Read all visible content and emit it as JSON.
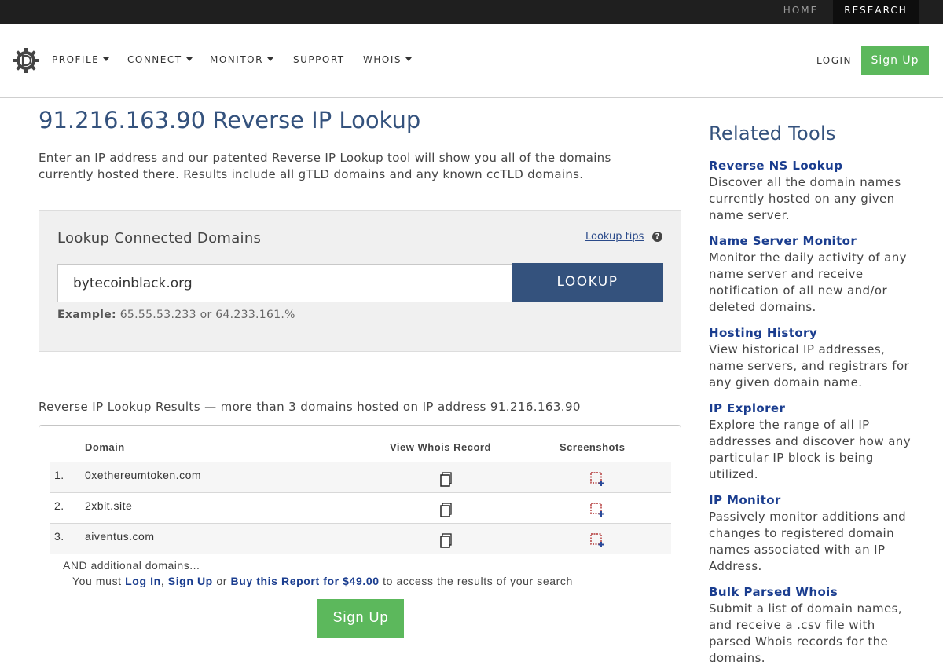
{
  "topbar": {
    "home": "HOME",
    "research": "RESEARCH"
  },
  "nav": {
    "items": [
      {
        "label": "PROFILE",
        "dropdown": true
      },
      {
        "label": "CONNECT",
        "dropdown": true
      },
      {
        "label": "MONITOR",
        "dropdown": true
      },
      {
        "label": "SUPPORT",
        "dropdown": false
      },
      {
        "label": "WHOIS",
        "dropdown": true
      }
    ],
    "login": "LOGIN",
    "signup": "Sign Up"
  },
  "main": {
    "title": "91.216.163.90 Reverse IP Lookup",
    "intro": "Enter an IP address and our patented Reverse IP Lookup tool will show you all of the domains currently hosted there. Results include all gTLD domains and any known ccTLD domains."
  },
  "lookup": {
    "title": "Lookup Connected Domains",
    "tips": "Lookup tips",
    "input_value": "bytecoinblack.org",
    "button": "LOOKUP",
    "example_label": "Example:",
    "example_text": "65.55.53.233 or 64.233.161.%"
  },
  "results": {
    "heading": "Reverse IP Lookup Results — more than 3 domains hosted on IP address 91.216.163.90",
    "columns": [
      "Domain",
      "View Whois Record",
      "Screenshots"
    ],
    "rows": [
      {
        "num": "1.",
        "domain": "0xethereumtoken.com"
      },
      {
        "num": "2.",
        "domain": "2xbit.site"
      },
      {
        "num": "3.",
        "domain": "aiventus.com"
      }
    ],
    "additional": "AND additional domains...",
    "must_prefix": "You must",
    "login_link": "Log In",
    "comma": ",",
    "signup_link": "Sign Up",
    "or": "or",
    "buy_link": "Buy this Report for $49.00",
    "must_suffix": "to access the results of your search",
    "signup_button": "Sign Up"
  },
  "sidebar": {
    "title": "Related Tools",
    "tools": [
      {
        "name": "Reverse NS Lookup",
        "desc": "Discover all the domain names currently hosted on any given name server."
      },
      {
        "name": "Name Server Monitor",
        "desc": "Monitor the daily activity of any name server and receive notification of all new and/or deleted domains."
      },
      {
        "name": "Hosting History",
        "desc": "View historical IP addresses, name servers, and registrars for any given domain name."
      },
      {
        "name": "IP Explorer",
        "desc": "Explore the range of all IP addresses and discover how any particular IP block is being utilized."
      },
      {
        "name": "IP Monitor",
        "desc": "Passively monitor additions and changes to registered domain names associated with an IP Address."
      },
      {
        "name": "Bulk Parsed Whois",
        "desc": "Submit a list of domain names, and receive a .csv file with parsed Whois records for the domains."
      }
    ]
  },
  "colors": {
    "brand_blue": "#34527d",
    "link_blue": "#1a3d8f",
    "green": "#5cb85c",
    "topbar": "#1f1f1f"
  }
}
